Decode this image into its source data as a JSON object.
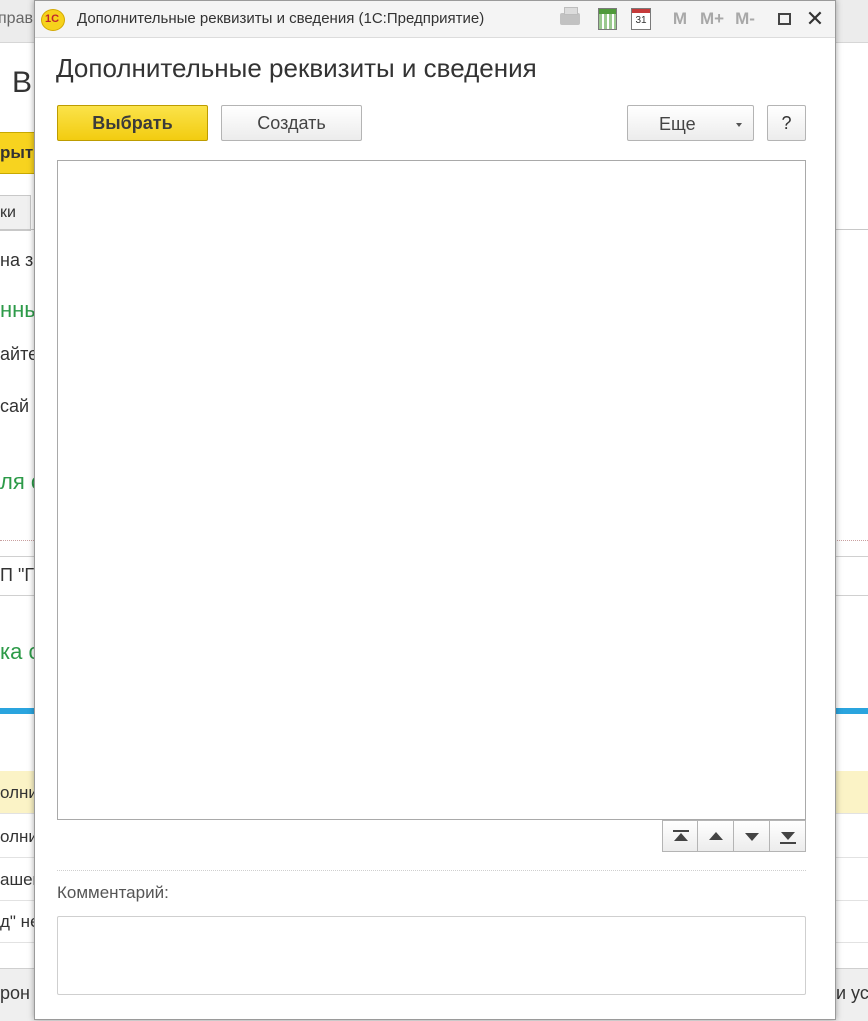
{
  "background": {
    "title_fragment": "прав",
    "heading_fragment": "В",
    "yellow_button_fragment": "рыт",
    "tab_fragment": "ки",
    "text_lines": [
      {
        "text": "на з",
        "kind": "plain"
      },
      {
        "text": "нны",
        "kind": "green"
      },
      {
        "text": "айте",
        "kind": "plain"
      },
      {
        "text": "сай",
        "kind": "plain"
      },
      {
        "text": "ля с",
        "kind": "green"
      },
      {
        "text": "П \"Г",
        "kind": "plain"
      },
      {
        "text": "ка с",
        "kind": "green"
      }
    ],
    "rows": [
      {
        "text": "олнит",
        "selected": true
      },
      {
        "text": "олнит",
        "selected": false
      },
      {
        "text": "ашен",
        "selected": false
      },
      {
        "text": "д\" не",
        "selected": false
      }
    ],
    "bottom_left": "рон",
    "bottom_right": "и ус"
  },
  "window": {
    "logo_text": "1С",
    "title": "Дополнительные реквизиты и сведения  (1С:Предприятие)",
    "memory_labels": [
      "M",
      "M+",
      "M-"
    ],
    "calendar_day": "31",
    "close_glyph": "✕"
  },
  "form": {
    "heading": "Дополнительные реквизиты и сведения",
    "buttons": {
      "choose": "Выбрать",
      "create": "Создать",
      "more": "Еще",
      "help": "?"
    },
    "list_items": [],
    "move_buttons": [
      "move-first",
      "move-up",
      "move-down",
      "move-last"
    ],
    "comment_label": "Комментарий:",
    "comment_value": ""
  },
  "colors": {
    "accent_yellow": "#f6d21c",
    "green_text": "#2c9a48",
    "blue_bar": "#2aa4de",
    "selection": "#fbf3c6"
  }
}
